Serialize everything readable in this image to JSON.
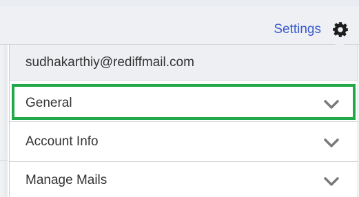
{
  "header": {
    "settings_label": "Settings",
    "settings_icon": "gear-icon"
  },
  "menu": {
    "account_email": "sudhakarthiy@rediffmail.com",
    "items": [
      {
        "label": "General",
        "icon": "chevron-down-icon",
        "highlighted": true
      },
      {
        "label": "Account Info",
        "icon": "chevron-down-icon",
        "highlighted": false
      },
      {
        "label": "Manage Mails",
        "icon": "chevron-down-icon",
        "highlighted": false
      }
    ]
  },
  "colors": {
    "link": "#3a5bd0",
    "highlight_border": "#22a94a",
    "header_background": "#eef0f3",
    "text": "#333333",
    "chevron": "#7a7a7a"
  }
}
